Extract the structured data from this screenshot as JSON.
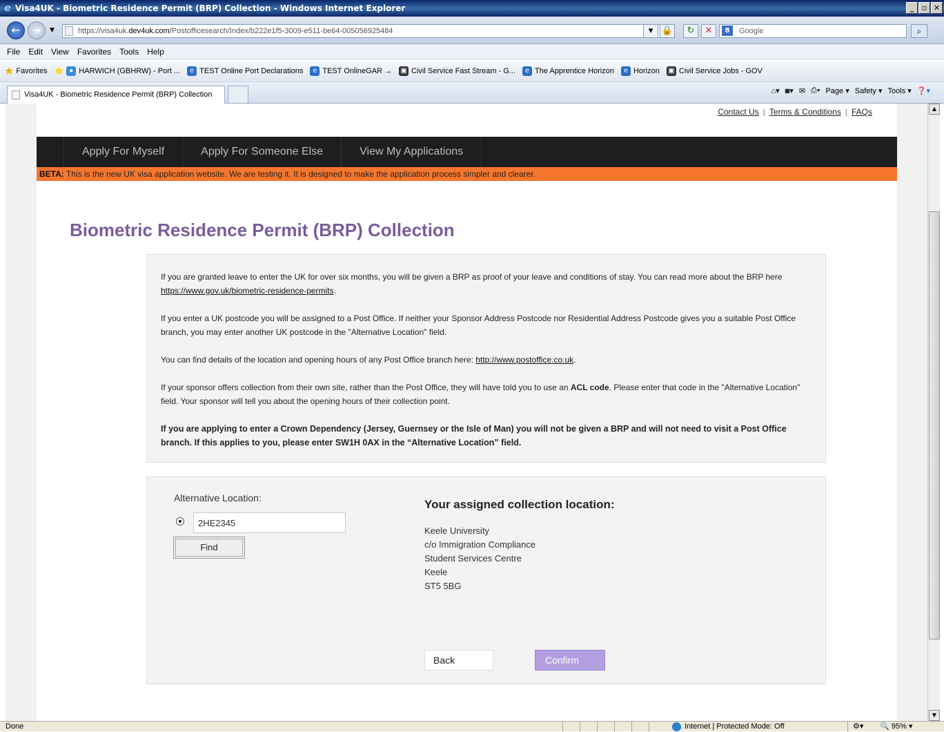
{
  "browser": {
    "title": "Visa4UK - Biometric Residence Permit (BRP) Collection - Windows Internet Explorer",
    "url_prefix": "https://visa4uk.",
    "url_host": "dev4uk.com",
    "url_path": "/Postofficesearch/Index/b222e1f5-3009-e511-be64-005056925484",
    "search_placeholder": "Google",
    "menu": [
      "File",
      "Edit",
      "View",
      "Favorites",
      "Tools",
      "Help"
    ],
    "favorites_label": "Favorites",
    "favorites": [
      "HARWICH (GBHRW) - Port ...",
      "TEST Online Port Declarations",
      "TEST OnlineGAR →",
      "Civil Service Fast Stream - G...",
      "The Apprentice  Horizon",
      "Horizon",
      "Civil Service Jobs - GOV"
    ],
    "tab_title": "Visa4UK - Biometric Residence Permit (BRP) Collection",
    "commands": [
      "Page ▾",
      "Safety ▾",
      "Tools ▾"
    ],
    "status_text": "Done",
    "zone_text": "Internet | Protected Mode: Off",
    "zoom": "95%"
  },
  "page": {
    "toplinks": [
      "Contact Us",
      "Terms & Conditions",
      "FAQs"
    ],
    "nav": [
      "Apply For Myself",
      "Apply For Someone Else",
      "View My Applications"
    ],
    "beta_label": "BETA:",
    "beta_text": "This is the new UK visa application website. We are testing it. It is designed to make the application process simpler and clearer.",
    "heading": "Biometric Residence Permit (BRP) Collection",
    "info": {
      "p1_text": "If you are granted leave to enter the UK for over six months, you will be given a BRP as proof of your leave and conditions of stay. You can read more about the BRP here ",
      "p1_link": "https://www.gov.uk/biometric-residence-permits",
      "p1_end": ".",
      "p2": "If you enter a UK postcode you will be assigned to a Post Office. If neither your Sponsor Address Postcode nor Residential Address Postcode gives you a suitable Post Office branch, you may enter another UK postcode in the \"Alternative Location\" field.",
      "p3_text": "You can find details of the location and opening hours of any Post Office branch here: ",
      "p3_link": "http://www.postoffice.co.uk",
      "p3_end": ".",
      "p4_a": "If your sponsor offers collection from their own site, rather than the Post Office, they will have told you to use an ",
      "p4_bold": "ACL code",
      "p4_b": ". Please enter that code in the \"Alternative Location\" field. Your sponsor will tell you about the opening hours of their collection point.",
      "p5": "If you are applying to enter a Crown Dependency (Jersey, Guernsey or the Isle of Man) you will not be given a BRP and will not need to visit a Post Office branch. If this applies to you, please enter SW1H 0AX in the “Alternative Location” field."
    },
    "form": {
      "alt_label": "Alternative Location:",
      "alt_value": "2HE2345",
      "find_label": "Find",
      "assigned_heading": "Your assigned collection location:",
      "address": [
        "Keele University",
        "c/o Immigration Compliance",
        "Student Services Centre",
        "Keele",
        "ST5 5BG"
      ],
      "back_label": "Back",
      "confirm_label": "Confirm"
    }
  }
}
